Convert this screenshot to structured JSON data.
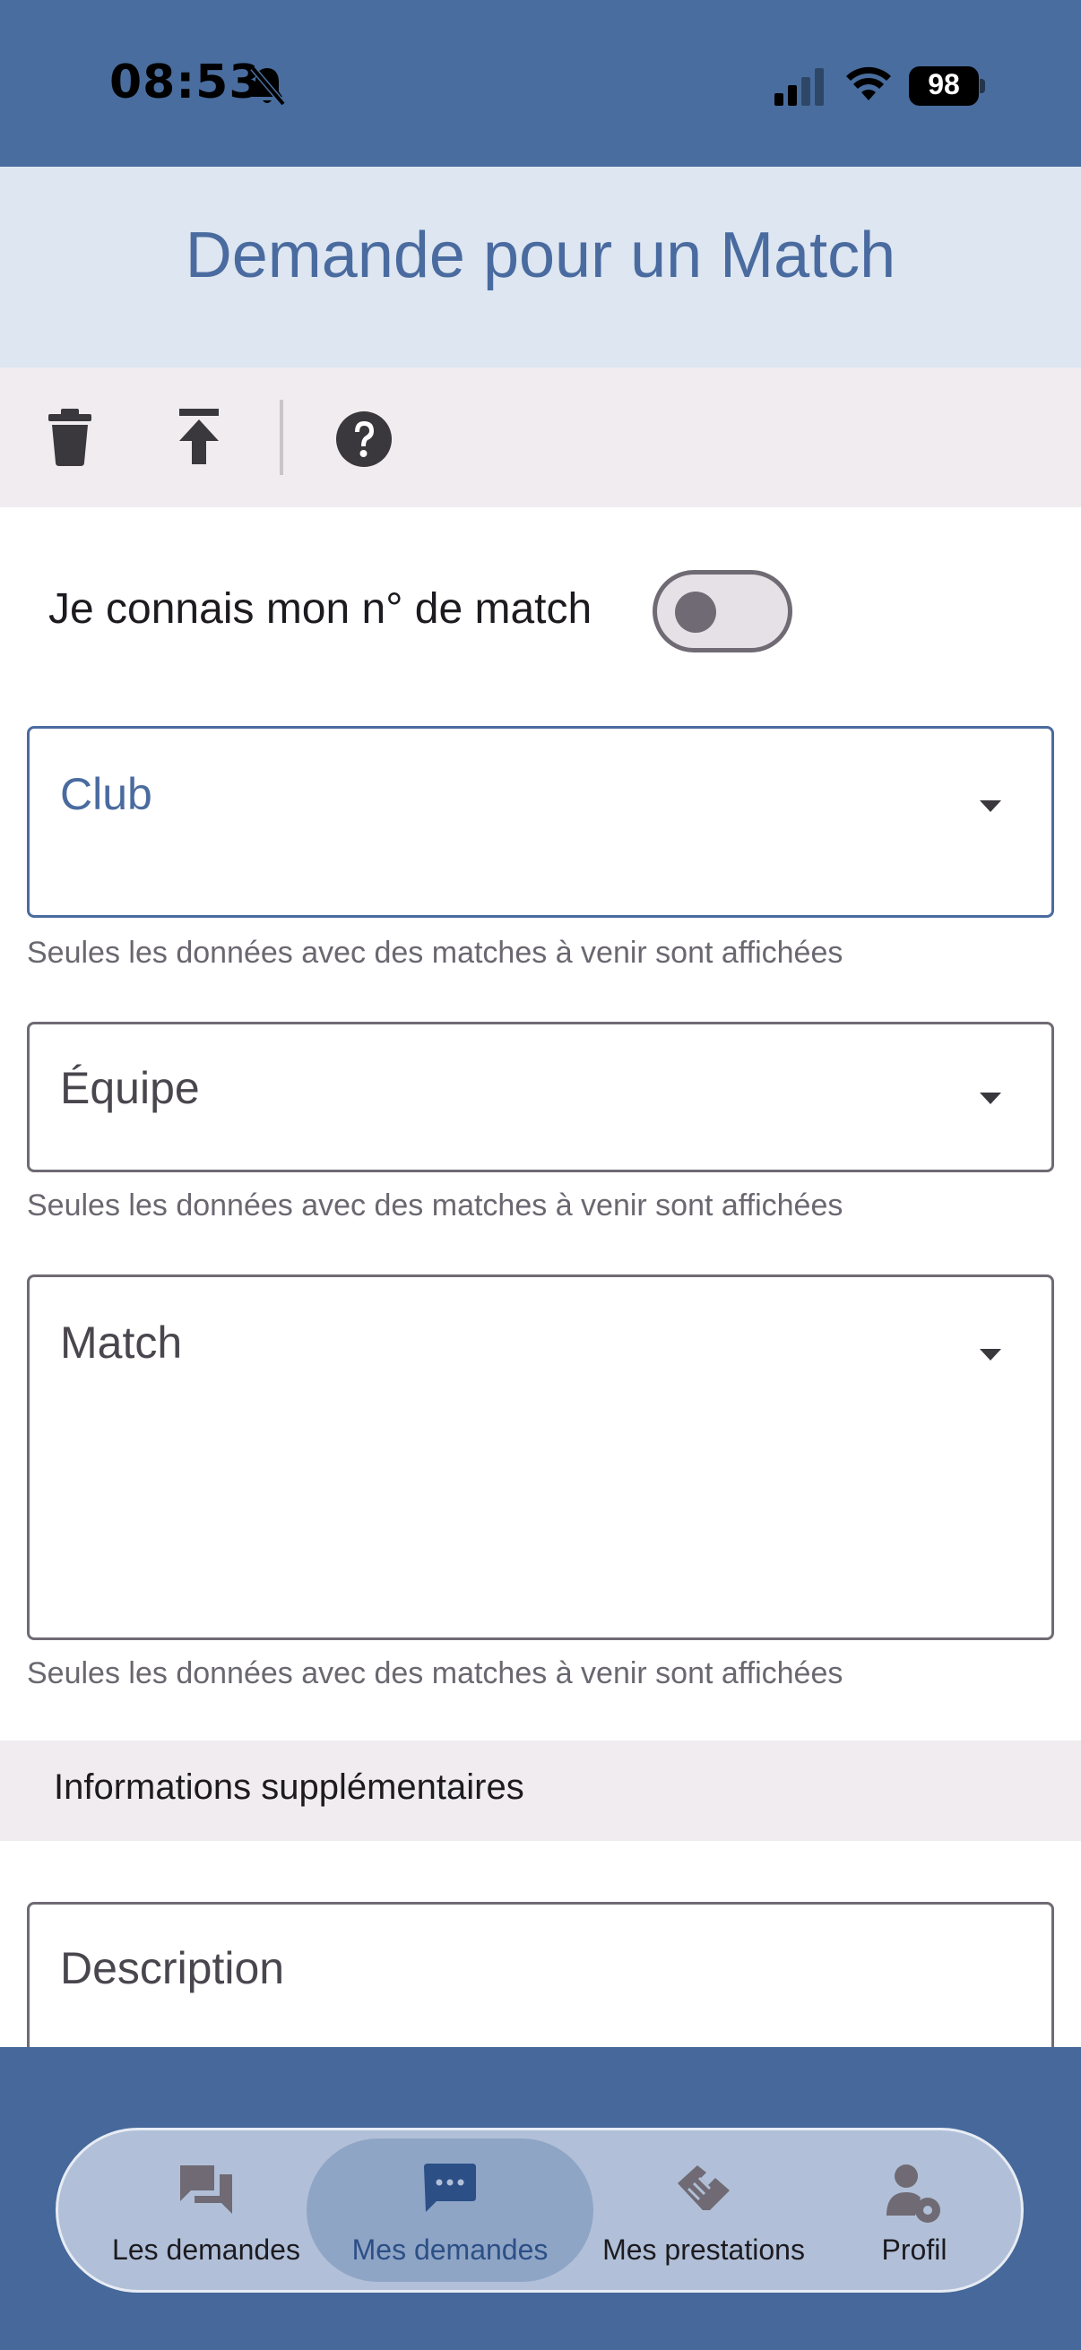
{
  "status_bar": {
    "time": "08:53",
    "battery": "98"
  },
  "header": {
    "title": "Demande pour un Match"
  },
  "toolbar": {
    "delete_icon": "trash-icon",
    "upload_icon": "upload-icon",
    "help_icon": "help-icon"
  },
  "form": {
    "toggle_label": "Je connais mon n° de match",
    "toggle_on": false,
    "club": {
      "label": "Club",
      "helper": "Seules les données avec des matches à venir sont affichées"
    },
    "equipe": {
      "label": "Équipe",
      "helper": "Seules les données avec des matches à venir sont affichées"
    },
    "match": {
      "label": "Match",
      "helper": "Seules les données avec des matches à venir sont affichées"
    },
    "section_title": "Informations supplémentaires",
    "description": {
      "label": "Description"
    }
  },
  "bottom_nav": {
    "items": [
      {
        "label": "Les demandes",
        "icon": "chat-bubbles-icon"
      },
      {
        "label": "Mes demandes",
        "icon": "message-dots-icon",
        "active": true
      },
      {
        "label": "Mes prestations",
        "icon": "handshake-icon"
      },
      {
        "label": "Profil",
        "icon": "user-settings-icon"
      }
    ]
  },
  "colors": {
    "primary": "#4a6b9f",
    "status_bar": "#496d9e",
    "header_bg": "#dde6f1",
    "toolbar_bg": "#f0ecf0"
  }
}
